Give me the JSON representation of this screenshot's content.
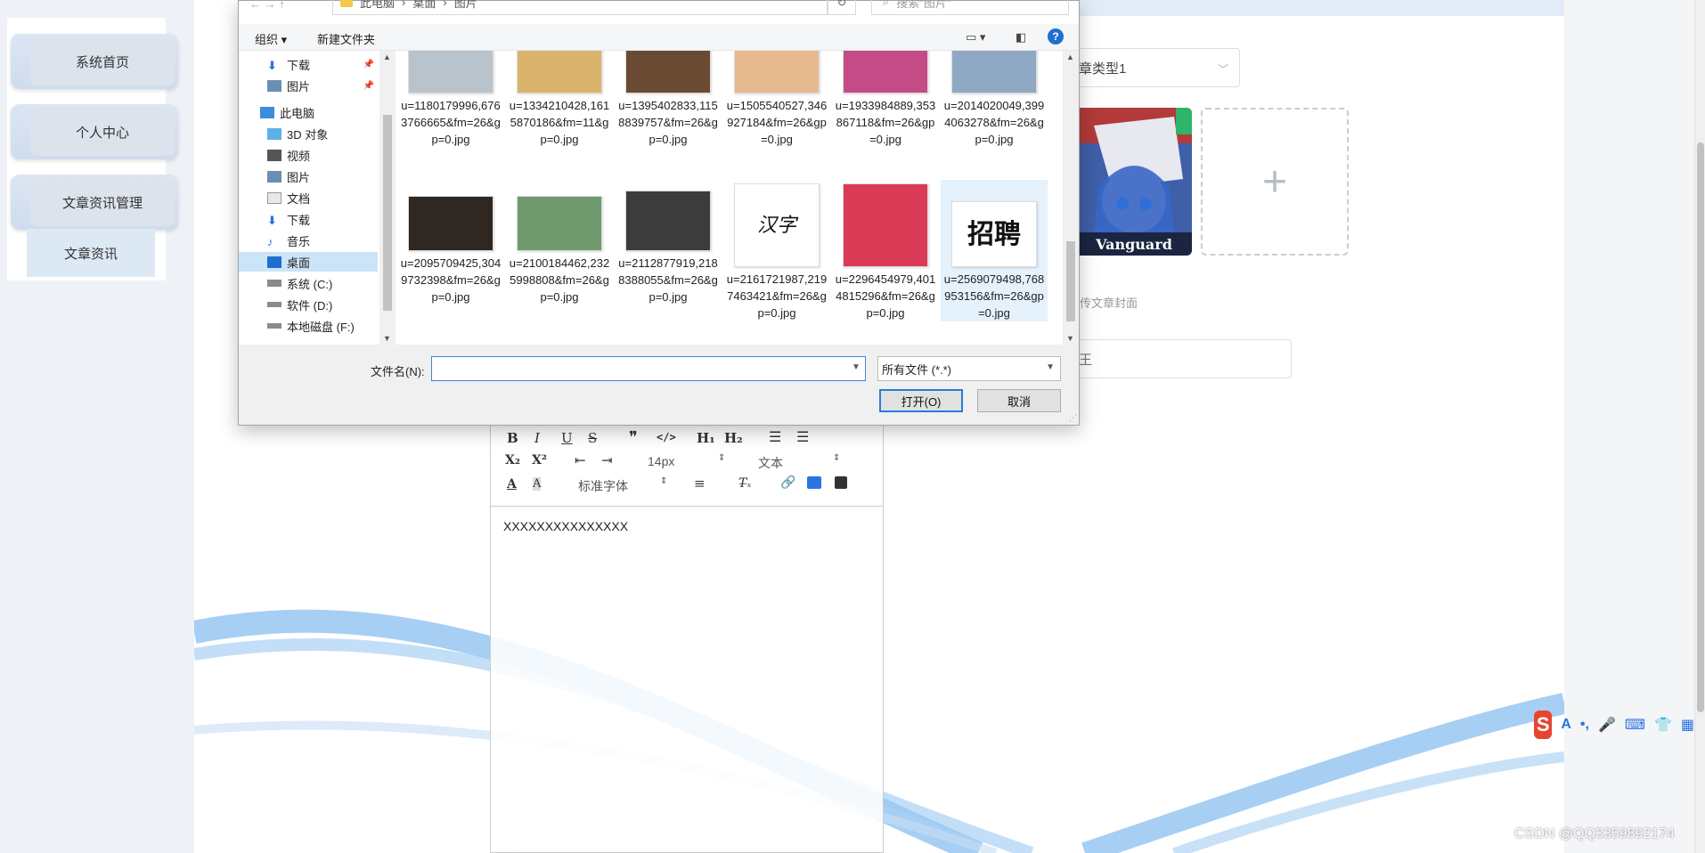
{
  "sidebar": {
    "items": [
      {
        "label": "系统首页"
      },
      {
        "label": "个人中心"
      },
      {
        "label": "文章资讯管理"
      }
    ],
    "sub_item": "文章资讯"
  },
  "form": {
    "type_select_value": "章类型1",
    "upload_plus": "+",
    "cover_hint": "传文章封面",
    "text_input_value": "王"
  },
  "editor": {
    "font_size": "14px",
    "text_type": "文本",
    "font_family": "标准字体",
    "content": "XXXXXXXXXXXXXXX",
    "toolbar": {
      "bold": "B",
      "italic": "I",
      "underline": "U",
      "strike": "S",
      "quote": "❞",
      "code": "</>",
      "h1": "H₁",
      "h2": "H₂",
      "subscript": "X₂",
      "superscript": "X²"
    }
  },
  "dialog": {
    "address": {
      "path": [
        "此电脑",
        "桌面",
        "图片"
      ],
      "search_placeholder": "搜索\"图片\""
    },
    "commands": {
      "organize": "组织 ▾",
      "new_folder": "新建文件夹",
      "help": "?"
    },
    "nav": [
      {
        "label": "下载",
        "icon": "download-icon",
        "pinned": true
      },
      {
        "label": "图片",
        "icon": "pictures-icon",
        "pinned": true
      },
      {
        "label": "此电脑",
        "icon": "computer-icon"
      },
      {
        "label": "3D 对象",
        "icon": "3d-objects-icon"
      },
      {
        "label": "视频",
        "icon": "video-icon"
      },
      {
        "label": "图片",
        "icon": "pictures-icon"
      },
      {
        "label": "文档",
        "icon": "documents-icon"
      },
      {
        "label": "下载",
        "icon": "download-icon"
      },
      {
        "label": "音乐",
        "icon": "music-icon"
      },
      {
        "label": "桌面",
        "icon": "desktop-icon",
        "selected": true
      },
      {
        "label": "系统 (C:)",
        "icon": "drive-icon"
      },
      {
        "label": "软件 (D:)",
        "icon": "drive-icon"
      },
      {
        "label": "本地磁盘 (F:)",
        "icon": "drive-icon"
      }
    ],
    "files_row1": [
      {
        "name": "u=1180179996,6763766665&fm=26&gp=0.jpg",
        "color": "#b9c3cc"
      },
      {
        "name": "u=1334210428,1615870186&fm=11&gp=0.jpg",
        "color": "#d9b36c"
      },
      {
        "name": "u=1395402833,1158839757&fm=26&gp=0.jpg",
        "color": "#6b4a33"
      },
      {
        "name": "u=1505540527,346927184&fm=26&gp=0.jpg",
        "color": "#e6b98f"
      },
      {
        "name": "u=1933984889,353867118&fm=26&gp=0.jpg",
        "color": "#c54b86"
      },
      {
        "name": "u=2014020049,3994063278&fm=26&gp=0.jpg",
        "color": "#8fa9c5"
      }
    ],
    "files_row2": [
      {
        "name": "u=2095709425,3049732398&fm=26&gp=0.jpg",
        "color": "#2e2722"
      },
      {
        "name": "u=2100184462,2325998808&fm=26&gp=0.jpg",
        "color": "#6e9a6e"
      },
      {
        "name": "u=2112877919,2188388055&fm=26&gp=0.jpg",
        "color": "#3c3c3c"
      },
      {
        "name": "u=2161721987,2197463421&fm=26&gp=0.jpg",
        "color": "#ffffff",
        "text": "汉字"
      },
      {
        "name": "u=2296454979,4014815296&fm=26&gp=0.jpg",
        "color": "#d93a55"
      },
      {
        "name": "u=2569079498,768953156&fm=26&gp=0.jpg",
        "color": "#ffffff",
        "text": "招聘",
        "selected": true
      }
    ],
    "filename_label": "文件名(N):",
    "filename_value": "",
    "filter": "所有文件 (*.*)",
    "open_button": "打开(O)",
    "cancel_button": "取消"
  },
  "watermark": "CSDN @QQ3359892174"
}
